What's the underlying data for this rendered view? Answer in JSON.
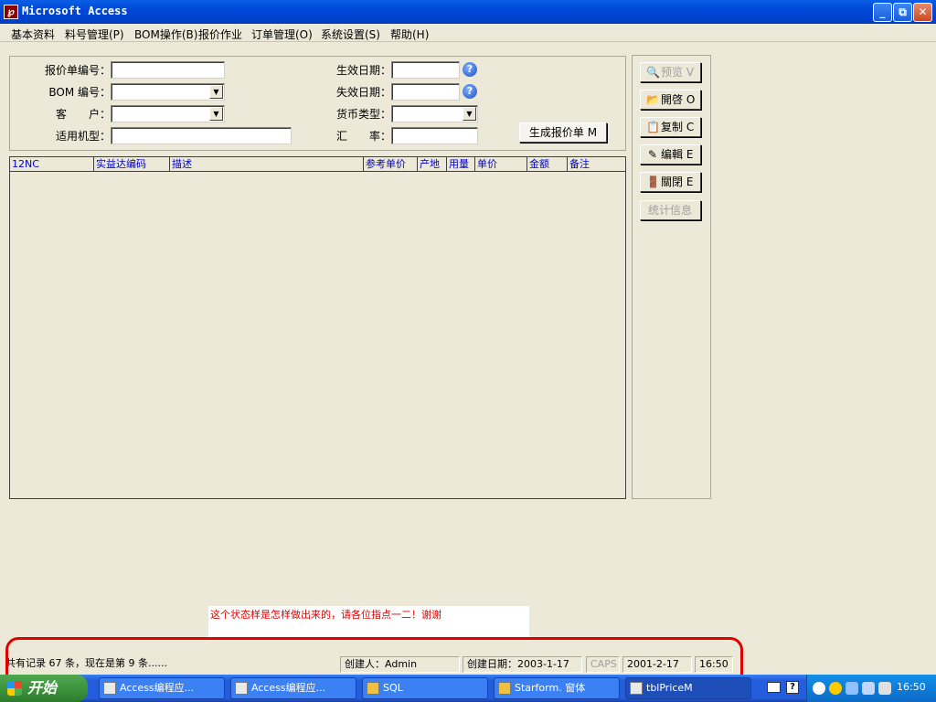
{
  "window": {
    "title": "Microsoft Access",
    "app_icon": "access-key-icon"
  },
  "menu": [
    "基本资料",
    "料号管理(P)",
    "BOM操作(B)",
    "报价作业",
    "订单管理(O)",
    "系统设置(S)",
    "帮助(H)"
  ],
  "form": {
    "quote_no_label": "报价单编号：",
    "bom_no_label": "BOM 编号：",
    "customer_label": "客　　户：",
    "model_label": "适用机型：",
    "effective_date_label": "生效日期：",
    "expire_date_label": "失效日期：",
    "currency_label": "货币类型：",
    "rate_label": "汇　　率：",
    "quote_no": "",
    "bom_no": "",
    "customer": "",
    "model": "",
    "effective_date": "",
    "expire_date": "",
    "currency": "",
    "rate": "",
    "generate_button": "生成报价单 M"
  },
  "grid": {
    "columns": [
      "12NC",
      "实益达编码",
      "描述",
      "参考单价",
      "产地",
      "用量",
      "单价",
      "金额",
      "备注"
    ],
    "rows": []
  },
  "buttons": {
    "preview": "预览 V",
    "open": "開啓 O",
    "copy": "复制 C",
    "edit": "编輯 E",
    "close": "關閉 E",
    "stats": "统计信息"
  },
  "annotation": "这个状态样是怎样做出来的，请各位指点一二！谢谢",
  "statusbar": {
    "records": "共有记录 67 条，现在是第 9 条......",
    "creator": "创建人：Admin",
    "created_date": "创建日期：2003-1-17",
    "caps": "CAPS",
    "date": "2001-2-17",
    "time": "16:50"
  },
  "taskbar": {
    "start_label": "开始",
    "tasks": [
      "Access编程应...",
      "Access编程应...",
      "SQL",
      "Starform. 窗体",
      "tblPriceM"
    ],
    "clock": "16:50"
  }
}
